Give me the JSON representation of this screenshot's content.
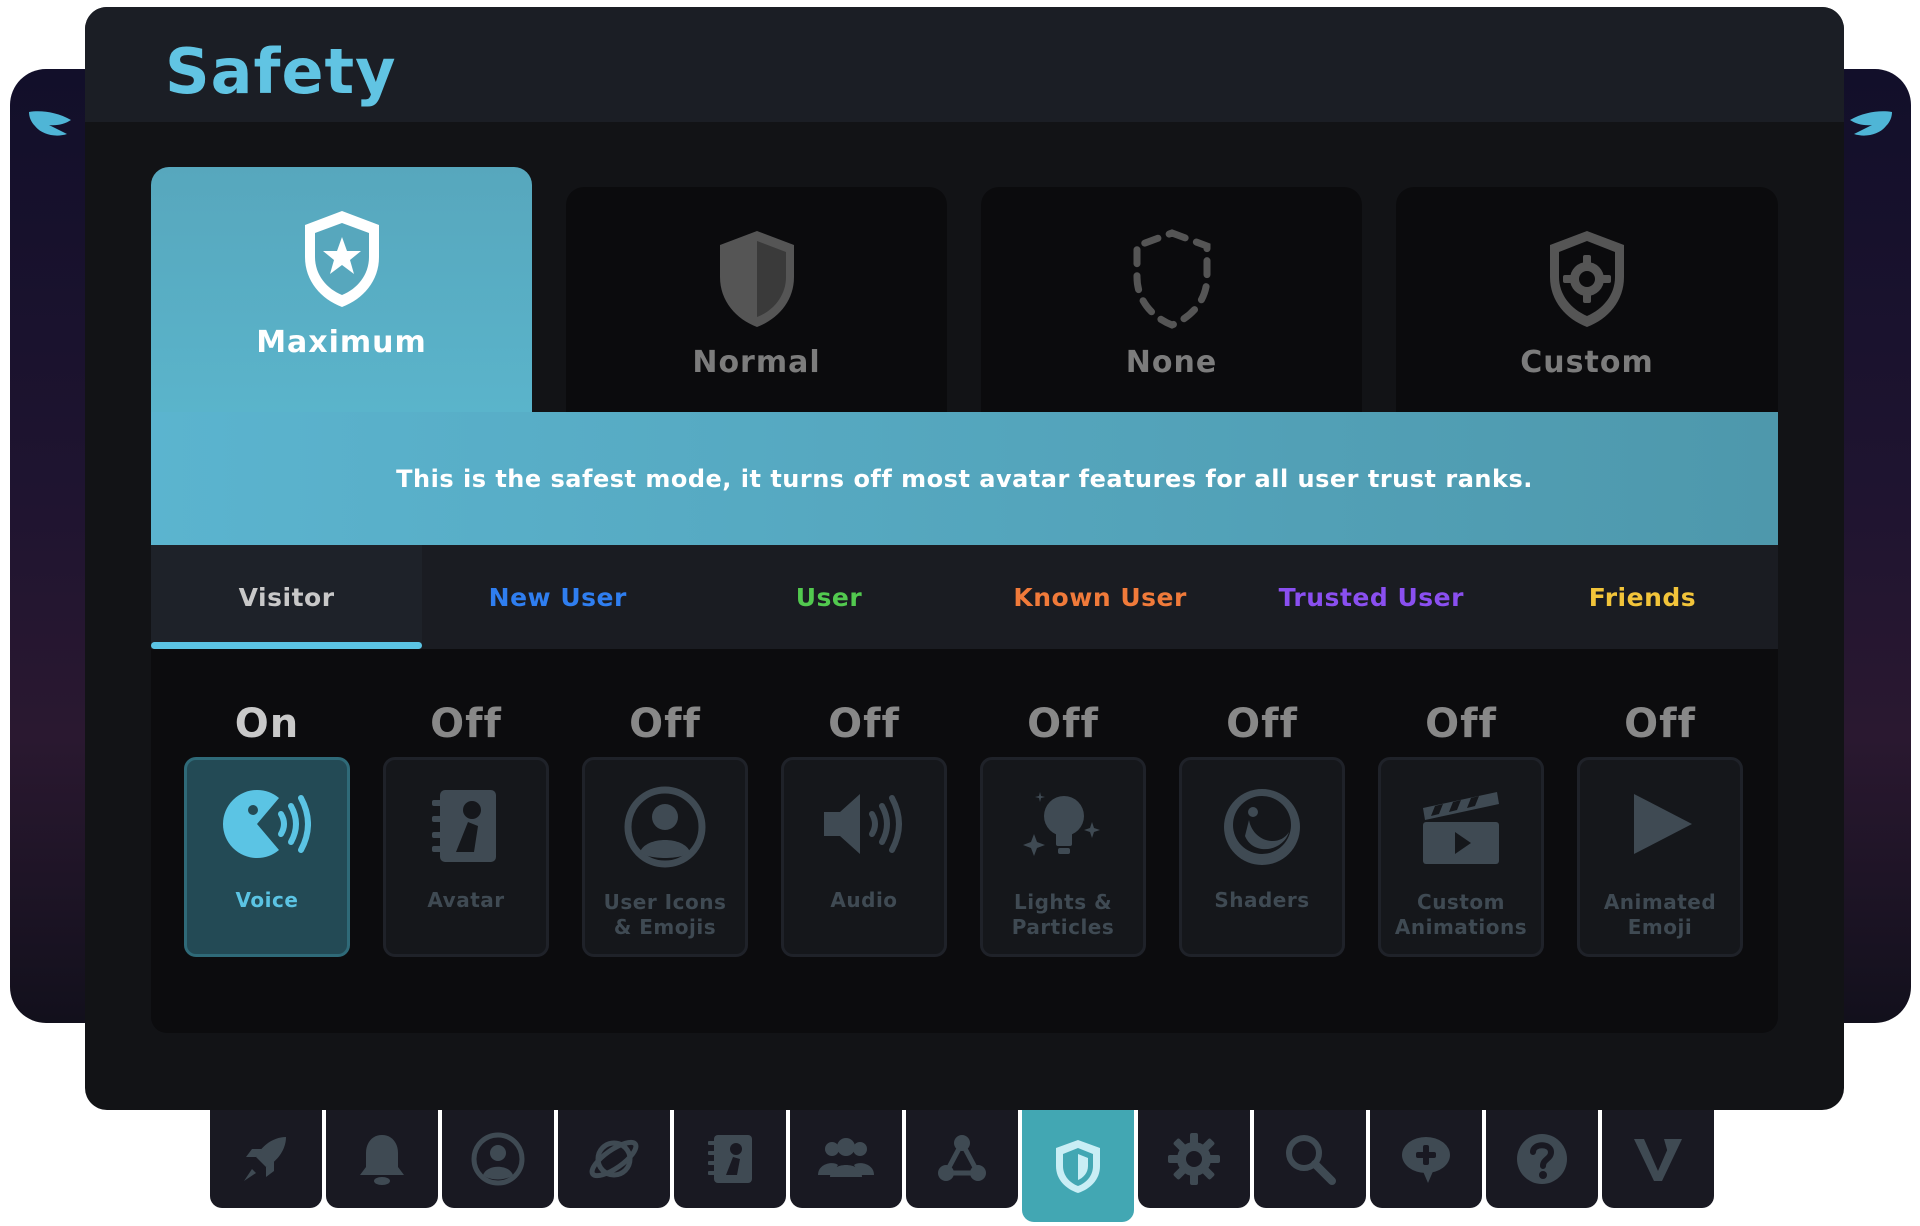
{
  "title": "Safety",
  "modes": [
    {
      "label": "Maximum",
      "icon": "shield-star-icon",
      "selected": true
    },
    {
      "label": "Normal",
      "icon": "shield-icon",
      "selected": false
    },
    {
      "label": "None",
      "icon": "shield-dashed-icon",
      "selected": false
    },
    {
      "label": "Custom",
      "icon": "shield-gear-icon",
      "selected": false
    }
  ],
  "description": "This is the safest mode, it turns off most avatar features for all user trust ranks.",
  "trust_tabs": [
    {
      "label": "Visitor",
      "color": "#c8c8c8",
      "selected": true
    },
    {
      "label": "New User",
      "color": "#2f7ef0",
      "selected": false
    },
    {
      "label": "User",
      "color": "#52c94f",
      "selected": false
    },
    {
      "label": "Known User",
      "color": "#f07a3a",
      "selected": false
    },
    {
      "label": "Trusted User",
      "color": "#8a4ff0",
      "selected": false
    },
    {
      "label": "Friends",
      "color": "#f2c43a",
      "selected": false
    }
  ],
  "permissions": [
    {
      "state": "On",
      "label": "Voice",
      "icon": "voice-icon"
    },
    {
      "state": "Off",
      "label": "Avatar",
      "icon": "avatar-book-icon"
    },
    {
      "state": "Off",
      "label": "User Icons\n& Emojis",
      "icon": "user-circle-icon"
    },
    {
      "state": "Off",
      "label": "Audio",
      "icon": "speaker-icon"
    },
    {
      "state": "Off",
      "label": "Lights &\nParticles",
      "icon": "lightbulb-icon"
    },
    {
      "state": "Off",
      "label": "Shaders",
      "icon": "shader-orb-icon"
    },
    {
      "state": "Off",
      "label": "Custom\nAnimations",
      "icon": "clapperboard-icon"
    },
    {
      "state": "Off",
      "label": "Animated\nEmoji",
      "icon": "play-icon"
    }
  ],
  "dock": [
    {
      "icon": "rocket-icon"
    },
    {
      "icon": "bell-icon"
    },
    {
      "icon": "profile-icon"
    },
    {
      "icon": "planet-icon"
    },
    {
      "icon": "avatar-book-icon"
    },
    {
      "icon": "social-icon"
    },
    {
      "icon": "network-icon"
    },
    {
      "icon": "shield-icon",
      "active": true
    },
    {
      "icon": "gear-icon"
    },
    {
      "icon": "search-icon"
    },
    {
      "icon": "chat-plus-icon"
    },
    {
      "icon": "help-icon"
    },
    {
      "icon": "vrchat-logo-icon"
    }
  ],
  "colors": {
    "accent": "#5bc4e4",
    "active_tile": "#234a55"
  }
}
